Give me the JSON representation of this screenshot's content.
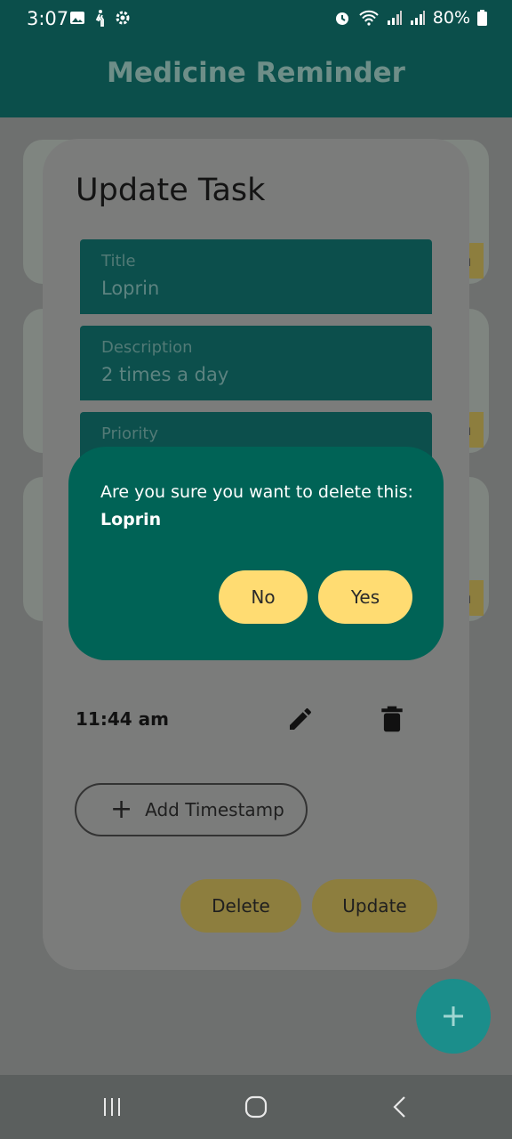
{
  "status_bar": {
    "time": "3:07",
    "battery": "80%",
    "icons": [
      "image-icon",
      "walking-icon",
      "settings-icon",
      "alarm-icon",
      "wifi-icon",
      "signal-icon",
      "signal-icon",
      "battery-icon"
    ]
  },
  "app_bar": {
    "title": "Medicine Reminder"
  },
  "update_dialog": {
    "title": "Update Task",
    "fields": [
      {
        "label": "Title",
        "value": "Loprin"
      },
      {
        "label": "Description",
        "value": "2 times a day"
      },
      {
        "label": "Priority",
        "value": ""
      }
    ],
    "timestamp": "11:44 am",
    "add_timestamp_label": "Add Timestamp",
    "delete_label": "Delete",
    "update_label": "Update"
  },
  "background_badges": [
    "n",
    "n",
    "n"
  ],
  "confirm_dialog": {
    "message": "Are you sure you want to delete this:",
    "item_name": "Loprin",
    "no_label": "No",
    "yes_label": "Yes"
  },
  "fab": {
    "icon": "plus-icon"
  },
  "colors": {
    "dialog": "#006356",
    "button": "#ffdc72",
    "appbar": "#0b4f4b"
  }
}
